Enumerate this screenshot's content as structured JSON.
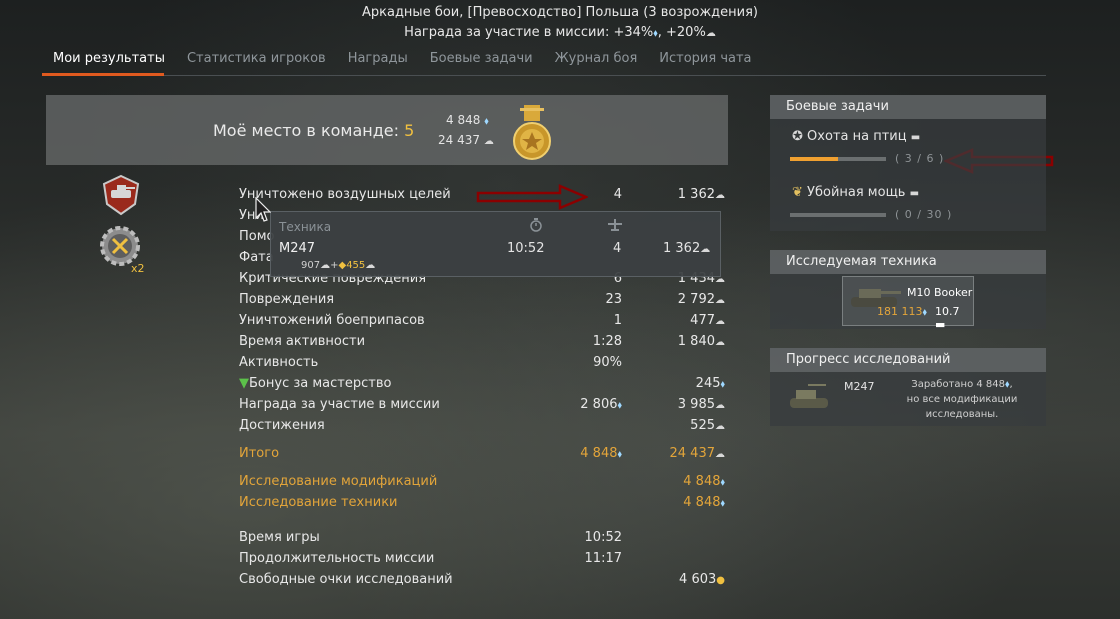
{
  "header": {
    "title": "Аркадные бои, [Превосходство] Польша (3 возрождения)",
    "reward_label": "Награда за участие в миссии: +34%",
    "reward_sep": ", +20%"
  },
  "tabs": [
    {
      "label": "Мои результаты",
      "active": true
    },
    {
      "label": "Статистика игроков"
    },
    {
      "label": "Награды"
    },
    {
      "label": "Боевые задачи"
    },
    {
      "label": "Журнал боя"
    },
    {
      "label": "История чата"
    }
  ],
  "place": {
    "label": "Моё место в команде: ",
    "value": "5",
    "rp": "4 848",
    "sl": "24 437"
  },
  "badges": {
    "multiplier": "x2"
  },
  "stats": [
    {
      "label": "Уничтожено воздушных целей",
      "count": "4",
      "reward": "1 362"
    },
    {
      "label": "Уни",
      "count": "",
      "reward": ""
    },
    {
      "label": "Помо",
      "count": "",
      "reward": ""
    },
    {
      "label": "Фата",
      "count": "",
      "reward": ""
    },
    {
      "label": "Критические повреждения",
      "count": "6",
      "reward": "1 434"
    },
    {
      "label": "Повреждения",
      "count": "23",
      "reward": "2 792"
    },
    {
      "label": "Уничтожений боеприпасов",
      "count": "1",
      "reward": "477"
    },
    {
      "label": "Время активности",
      "count": "1:28",
      "reward": "1 840"
    },
    {
      "label": "Активность",
      "count": "90%",
      "reward": ""
    },
    {
      "label": "Бонус за мастерство",
      "count": "",
      "reward": "245"
    },
    {
      "label": "Награда за участие в миссии",
      "count": "2 806",
      "reward": "3 985"
    },
    {
      "label": "Достижения",
      "count": "",
      "reward": "525"
    }
  ],
  "totals": {
    "total_label": "Итого",
    "total_rp": "4 848",
    "total_sl": "24 437",
    "mod_label": "Исследование модификаций",
    "mod_val": "4 848",
    "veh_label": "Исследование техники",
    "veh_val": "4 848"
  },
  "time": {
    "game_label": "Время игры",
    "game_val": "10:52",
    "mission_label": "Продолжительность миссии",
    "mission_val": "11:17",
    "free_label": "Свободные очки исследований",
    "free_val": "4 603"
  },
  "tooltip": {
    "header": "Техника",
    "name": "M247",
    "time": "10:52",
    "kills": "4",
    "reward": "1 362",
    "sub_a": "907",
    "sub_b": "455"
  },
  "tasks_panel": {
    "title": "Боевые задачи",
    "items": [
      {
        "name": "Охота на птиц",
        "progress": "( 3 / 6 )",
        "fraction": 0.5
      },
      {
        "name": "Убойная мощь",
        "progress": "( 0 / 30 )",
        "fraction": 0
      }
    ]
  },
  "research_panel": {
    "title": "Исследуемая техника",
    "vehicle": "M10 Booker",
    "xp": "181 113",
    "br": "10.7"
  },
  "progress_panel": {
    "title": "Прогресс исследований",
    "vehicle": "M247",
    "earned": "Заработано 4 848",
    "line2": "но все модификации",
    "line3": "исследованы."
  },
  "colors": {
    "accent": "#e05a1f",
    "gold": "#f0c040",
    "orange": "#e3a53a",
    "rp": "#9fd8ff",
    "arrow": "#8b0000"
  }
}
